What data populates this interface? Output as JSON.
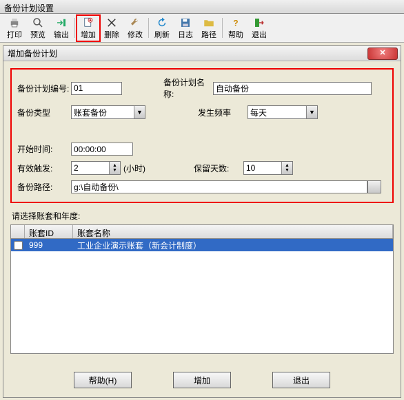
{
  "window": {
    "title": "备份计划设置"
  },
  "toolbar": {
    "print": "打印",
    "preview": "预览",
    "output": "输出",
    "add": "增加",
    "delete": "删除",
    "modify": "修改",
    "refresh": "刷新",
    "log": "日志",
    "path": "路径",
    "help": "帮助",
    "exit": "退出"
  },
  "dialog": {
    "title": "增加备份计划",
    "close_glyph": "✕",
    "labels": {
      "plan_no": "备份计划编号:",
      "plan_name": "备份计划名称:",
      "backup_type": "备份类型",
      "frequency": "发生频率",
      "start_time": "开始时间:",
      "trigger": "有效触发:",
      "trigger_unit": "(小时)",
      "retain_days": "保留天数:",
      "backup_path": "备份路径:"
    },
    "values": {
      "plan_no": "01",
      "plan_name": "自动备份",
      "backup_type": "账套备份",
      "frequency": "每天",
      "start_time": "00:00:00",
      "trigger": "2",
      "retain_days": "10",
      "backup_path": "g:\\自动备份\\"
    },
    "note": "请选择账套和年度:",
    "grid": {
      "headers": {
        "id": "账套ID",
        "name": "账套名称"
      },
      "rows": [
        {
          "checked": false,
          "id": "999",
          "name": "工业企业演示账套（新会计制度）"
        }
      ]
    },
    "buttons": {
      "help": "帮助(H)",
      "add": "增加",
      "exit": "退出"
    }
  }
}
